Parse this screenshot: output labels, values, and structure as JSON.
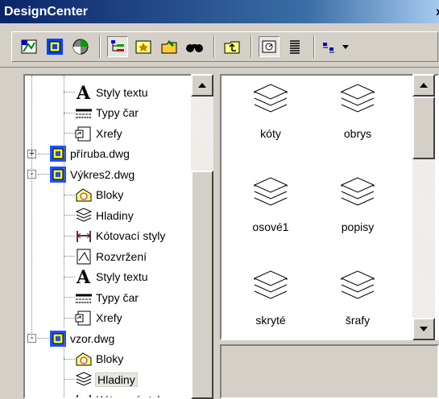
{
  "window": {
    "title": "DesignCenter"
  },
  "toolbar": {
    "buttons": [
      {
        "icon": "desktop-icon"
      },
      {
        "icon": "open-drawings-icon"
      },
      {
        "icon": "history-icon"
      },
      {
        "icon": "tree-toggle-icon"
      },
      {
        "icon": "favorites-icon"
      },
      {
        "icon": "load-icon"
      },
      {
        "icon": "find-icon"
      },
      {
        "icon": "up-icon"
      },
      {
        "icon": "preview-icon"
      },
      {
        "icon": "description-icon"
      },
      {
        "icon": "views-icon"
      }
    ]
  },
  "tree": {
    "items": [
      {
        "label": "Styly textu",
        "icon": "text-style-icon",
        "level": 3
      },
      {
        "label": "Typy čar",
        "icon": "linetype-icon",
        "level": 3
      },
      {
        "label": "Xrefy",
        "icon": "xref-icon",
        "level": 3
      },
      {
        "label": "příruba.dwg",
        "icon": "drawing-icon",
        "level": 2,
        "expander": "+"
      },
      {
        "label": "Výkres2.dwg",
        "icon": "drawing-icon",
        "level": 2,
        "expander": "−"
      },
      {
        "label": "Bloky",
        "icon": "block-icon",
        "level": 3
      },
      {
        "label": "Hladiny",
        "icon": "layer-icon",
        "level": 3
      },
      {
        "label": "Kótovací styly",
        "icon": "dimstyle-icon",
        "level": 3
      },
      {
        "label": "Rozvržení",
        "icon": "layout-icon",
        "level": 3
      },
      {
        "label": "Styly textu",
        "icon": "text-style-icon",
        "level": 3
      },
      {
        "label": "Typy čar",
        "icon": "linetype-icon",
        "level": 3
      },
      {
        "label": "Xrefy",
        "icon": "xref-icon",
        "level": 3
      },
      {
        "label": "vzor.dwg",
        "icon": "drawing-icon",
        "level": 2,
        "expander": "−"
      },
      {
        "label": "Bloky",
        "icon": "block-icon",
        "level": 3
      },
      {
        "label": "Hladiny",
        "icon": "layer-icon",
        "level": 3,
        "selected": true
      },
      {
        "label": "Kótovací styly",
        "icon": "dimstyle-icon",
        "level": 3
      }
    ]
  },
  "content": {
    "items": [
      {
        "label": "kóty"
      },
      {
        "label": "obrys"
      },
      {
        "label": "osové1"
      },
      {
        "label": "popisy"
      },
      {
        "label": "skryté"
      },
      {
        "label": "šrafy"
      }
    ]
  }
}
